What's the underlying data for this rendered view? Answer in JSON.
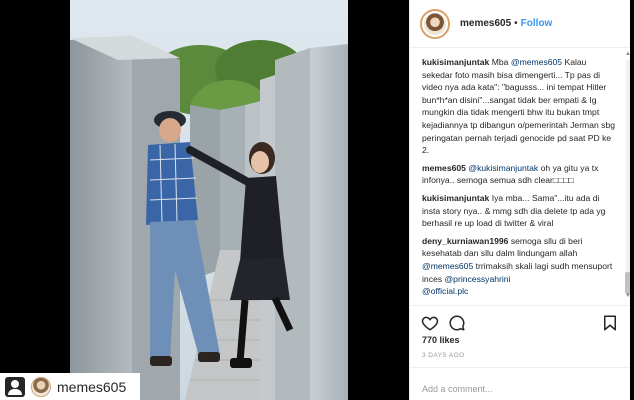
{
  "post": {
    "username": "memes605",
    "follow_label": "Follow",
    "separator": "•",
    "likes": "770 likes",
    "date": "3 DAYS AGO",
    "comment_placeholder": "Add a comment..."
  },
  "bottom_bar": {
    "username": "memes605"
  },
  "comments": [
    {
      "user": "kukisimanjuntak",
      "pre": " Mba ",
      "mention": "@memes605",
      "post": " Kalau sekedar foto masih bisa dimengerti... Tp pas di video nya ada kata\": \"bagusss... ini tempat Hitler bun*h*an disini\"...sangat tidak ber empati & Ig mungkin dia tidak mengerti bhw itu bukan tmpt kejadiannya tp dibangun o/pemerintah Jerman sbg peringatan pernah terjadi genocide pd saat PD ke 2."
    },
    {
      "user": "memes605",
      "pre": " ",
      "mention": "@kukisimanjuntak",
      "post": " oh ya gitu ya tx infonya.. semoga semua sdh clear□□□□"
    },
    {
      "user": "kukisimanjuntak",
      "pre": " Iya mba... Sama\"...itu ada di insta story nya.. & mmg sdh dia delete tp ada yg berhasil re up load di twitter & viral",
      "mention": "",
      "post": ""
    },
    {
      "user": "deny_kurniawan1996",
      "pre": " semoga sllu di beri kesehatab dan sllu dalm lindungam allah ",
      "mention": "@memes605",
      "post": " trrimaksih skali lagi sudh mensuport inces ",
      "mention2": "@princessyahrini",
      "mention3": "@official.plc"
    }
  ],
  "icons": {
    "like": "heart-icon",
    "comment": "comment-icon",
    "save": "bookmark-icon"
  },
  "colors": {
    "follow": "#3897f0",
    "mention": "#003569",
    "text": "#262626",
    "muted": "#999999"
  }
}
